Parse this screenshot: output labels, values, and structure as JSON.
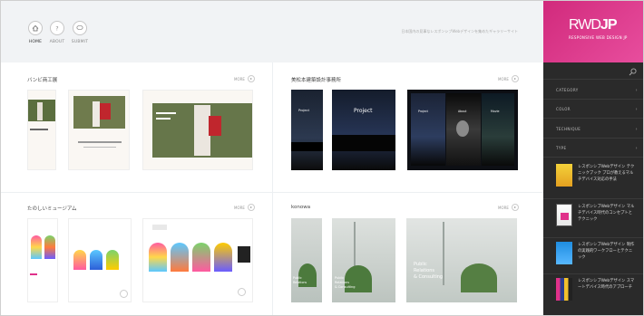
{
  "header": {
    "nav": [
      {
        "label": "HOME",
        "icon": "house-icon"
      },
      {
        "label": "ABOUT",
        "icon": "question-icon"
      },
      {
        "label": "SUBMIT",
        "icon": "speech-bubble-icon"
      }
    ],
    "tagline": "日本国内の見事なレスポンシブWebデザインを集めたギャラリーサイト"
  },
  "cards": [
    {
      "title": "バンビ商工展",
      "more": "MORE"
    },
    {
      "title": "美松本建築設計事務所",
      "more": "MORE"
    },
    {
      "title": "たのしいミュージアム",
      "more": "MORE"
    },
    {
      "title": "konowa",
      "more": "MORE"
    }
  ],
  "shot_text": {
    "b_desktop": "Project",
    "b_tab": "Project",
    "b_about": "About",
    "b_movie": "Movie",
    "k_line1": "Public",
    "k_line2": "Relations",
    "k_line3": "& Consulting"
  },
  "sidebar": {
    "logo": {
      "brand_a": "RWD",
      "brand_b": "JP",
      "subtitle": "RESPONSIVE WEB DESIGN JP"
    },
    "menu": [
      {
        "label": "CATEGORY"
      },
      {
        "label": "COLOR"
      },
      {
        "label": "TECHNIQUE"
      },
      {
        "label": "TYPE"
      }
    ],
    "articles": [
      {
        "title": "レスポンシブWebデザイン テクニックブック プロが教えるマルチデバイス対応の手法"
      },
      {
        "title": "レスポンシブWebデザイン マルチデバイス時代のコンセプトとテクニック"
      },
      {
        "title": "レスポンシブWebデザイン 制作の実践的ワークフローとテクニック"
      },
      {
        "title": "レスポンシブWebデザイン スマートデバイス時代のアプローチ"
      }
    ]
  },
  "colors": {
    "accent": "#e0318a",
    "sidebar_bg": "#2a2a2a",
    "header_bg": "#f1f3f5"
  }
}
